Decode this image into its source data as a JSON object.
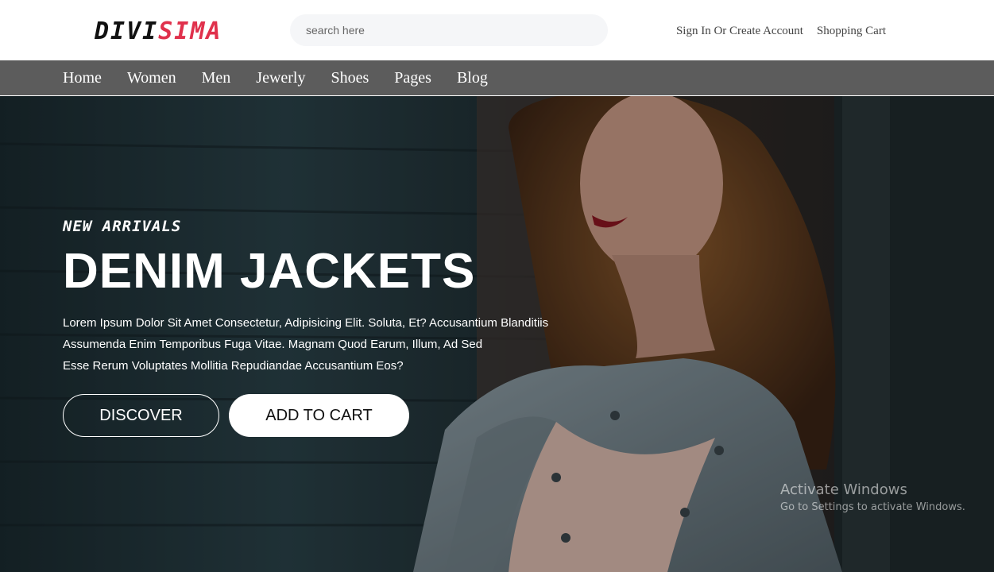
{
  "brand": {
    "part1": "DIVI",
    "part2": "SIMA",
    "accent_color": "#e0314c"
  },
  "search": {
    "placeholder": "search here"
  },
  "top_links": {
    "sign_in": "Sign In Or Create Account",
    "cart": "Shopping Cart"
  },
  "nav": {
    "items": [
      "Home",
      "Women",
      "Men",
      "Jewerly",
      "Shoes",
      "Pages",
      "Blog"
    ]
  },
  "hero": {
    "eyebrow": "NEW ARRIVALS",
    "title": "DENIM JACKETS",
    "description": [
      "Lorem Ipsum Dolor Sit Amet Consectetur, Adipisicing Elit. Soluta, Et? Accusantium Blanditiis",
      "Assumenda Enim Temporibus Fuga Vitae. Magnam Quod Earum, Illum, Ad Sed",
      "Esse Rerum Voluptates Mollitia Repudiandae Accusantium Eos?"
    ],
    "discover_label": "DISCOVER",
    "cart_label": "ADD TO CART"
  },
  "watermark": {
    "line1": "Activate Windows",
    "line2": "Go to Settings to activate Windows."
  }
}
